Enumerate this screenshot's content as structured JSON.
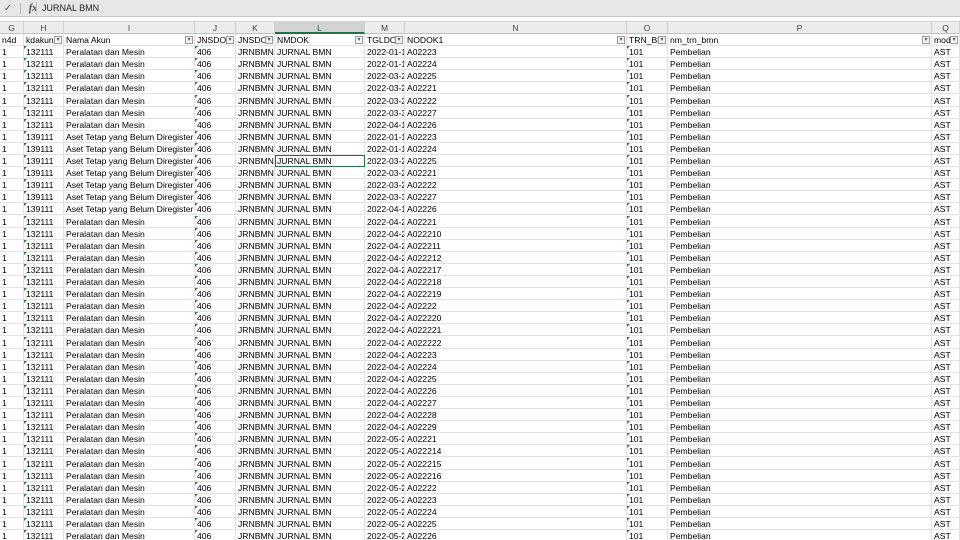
{
  "formula_bar": {
    "check_glyph": "✓",
    "fx_label": "fx",
    "value": "JURNAL BMN"
  },
  "columns": [
    {
      "letter": "G",
      "header": "n4d"
    },
    {
      "letter": "H",
      "header": "kdakun"
    },
    {
      "letter": "I",
      "header": "Nama Akun"
    },
    {
      "letter": "J",
      "header": "JNSDOK"
    },
    {
      "letter": "K",
      "header": "JNSDOK"
    },
    {
      "letter": "L",
      "header": "NMDOK"
    },
    {
      "letter": "M",
      "header": "TGLDOK"
    },
    {
      "letter": "N",
      "header": "NODOK1"
    },
    {
      "letter": "O",
      "header": "TRN_BM"
    },
    {
      "letter": "P",
      "header": "nm_trn_bmn"
    },
    {
      "letter": "Q",
      "header": "modul"
    }
  ],
  "active_column": "L",
  "selected_row": 9,
  "rows": [
    [
      "1",
      "132111",
      "Peralatan dan Mesin",
      "406",
      "JRNBMN",
      "JURNAL BMN",
      "2022-01-1",
      "A02223",
      "101",
      "Pembelian",
      "AST"
    ],
    [
      "1",
      "132111",
      "Peralatan dan Mesin",
      "406",
      "JRNBMN",
      "JURNAL BMN",
      "2022-01-1",
      "A02224",
      "101",
      "Pembelian",
      "AST"
    ],
    [
      "1",
      "132111",
      "Peralatan dan Mesin",
      "406",
      "JRNBMN",
      "JURNAL BMN",
      "2022-03-2",
      "A02225",
      "101",
      "Pembelian",
      "AST"
    ],
    [
      "1",
      "132111",
      "Peralatan dan Mesin",
      "406",
      "JRNBMN",
      "JURNAL BMN",
      "2022-03-2",
      "A02221",
      "101",
      "Pembelian",
      "AST"
    ],
    [
      "1",
      "132111",
      "Peralatan dan Mesin",
      "406",
      "JRNBMN",
      "JURNAL BMN",
      "2022-03-2",
      "A02222",
      "101",
      "Pembelian",
      "AST"
    ],
    [
      "1",
      "132111",
      "Peralatan dan Mesin",
      "406",
      "JRNBMN",
      "JURNAL BMN",
      "2022-03-3",
      "A02227",
      "101",
      "Pembelian",
      "AST"
    ],
    [
      "1",
      "132111",
      "Peralatan dan Mesin",
      "406",
      "JRNBMN",
      "JURNAL BMN",
      "2022-04-1",
      "A02226",
      "101",
      "Pembelian",
      "AST"
    ],
    [
      "1",
      "139111",
      "Aset Tetap yang Belum Diregister",
      "406",
      "JRNBMN",
      "JURNAL BMN",
      "2022-01-1",
      "A02223",
      "101",
      "Pembelian",
      "AST"
    ],
    [
      "1",
      "139111",
      "Aset Tetap yang Belum Diregister",
      "406",
      "JRNBMN",
      "JURNAL BMN",
      "2022-01-1",
      "A02224",
      "101",
      "Pembelian",
      "AST"
    ],
    [
      "1",
      "139111",
      "Aset Tetap yang Belum Diregister",
      "406",
      "JRNBMN",
      "JURNAL BMN",
      "2022-03-2",
      "A02225",
      "101",
      "Pembelian",
      "AST"
    ],
    [
      "1",
      "139111",
      "Aset Tetap yang Belum Diregister",
      "406",
      "JRNBMN",
      "JURNAL BMN",
      "2022-03-2",
      "A02221",
      "101",
      "Pembelian",
      "AST"
    ],
    [
      "1",
      "139111",
      "Aset Tetap yang Belum Diregister",
      "406",
      "JRNBMN",
      "JURNAL BMN",
      "2022-03-2",
      "A02222",
      "101",
      "Pembelian",
      "AST"
    ],
    [
      "1",
      "139111",
      "Aset Tetap yang Belum Diregister",
      "406",
      "JRNBMN",
      "JURNAL BMN",
      "2022-03-3",
      "A02227",
      "101",
      "Pembelian",
      "AST"
    ],
    [
      "1",
      "139111",
      "Aset Tetap yang Belum Diregister",
      "406",
      "JRNBMN",
      "JURNAL BMN",
      "2022-04-1",
      "A02226",
      "101",
      "Pembelian",
      "AST"
    ],
    [
      "1",
      "132111",
      "Peralatan dan Mesin",
      "406",
      "JRNBMN",
      "JURNAL BMN",
      "2022-04-2",
      "A02221",
      "101",
      "Pembelian",
      "AST"
    ],
    [
      "1",
      "132111",
      "Peralatan dan Mesin",
      "406",
      "JRNBMN",
      "JURNAL BMN",
      "2022-04-2",
      "A022210",
      "101",
      "Pembelian",
      "AST"
    ],
    [
      "1",
      "132111",
      "Peralatan dan Mesin",
      "406",
      "JRNBMN",
      "JURNAL BMN",
      "2022-04-2",
      "A022211",
      "101",
      "Pembelian",
      "AST"
    ],
    [
      "1",
      "132111",
      "Peralatan dan Mesin",
      "406",
      "JRNBMN",
      "JURNAL BMN",
      "2022-04-2",
      "A022212",
      "101",
      "Pembelian",
      "AST"
    ],
    [
      "1",
      "132111",
      "Peralatan dan Mesin",
      "406",
      "JRNBMN",
      "JURNAL BMN",
      "2022-04-2",
      "A022217",
      "101",
      "Pembelian",
      "AST"
    ],
    [
      "1",
      "132111",
      "Peralatan dan Mesin",
      "406",
      "JRNBMN",
      "JURNAL BMN",
      "2022-04-2",
      "A022218",
      "101",
      "Pembelian",
      "AST"
    ],
    [
      "1",
      "132111",
      "Peralatan dan Mesin",
      "406",
      "JRNBMN",
      "JURNAL BMN",
      "2022-04-2",
      "A022219",
      "101",
      "Pembelian",
      "AST"
    ],
    [
      "1",
      "132111",
      "Peralatan dan Mesin",
      "406",
      "JRNBMN",
      "JURNAL BMN",
      "2022-04-2",
      "A02222",
      "101",
      "Pembelian",
      "AST"
    ],
    [
      "1",
      "132111",
      "Peralatan dan Mesin",
      "406",
      "JRNBMN",
      "JURNAL BMN",
      "2022-04-2",
      "A022220",
      "101",
      "Pembelian",
      "AST"
    ],
    [
      "1",
      "132111",
      "Peralatan dan Mesin",
      "406",
      "JRNBMN",
      "JURNAL BMN",
      "2022-04-2",
      "A022221",
      "101",
      "Pembelian",
      "AST"
    ],
    [
      "1",
      "132111",
      "Peralatan dan Mesin",
      "406",
      "JRNBMN",
      "JURNAL BMN",
      "2022-04-2",
      "A022222",
      "101",
      "Pembelian",
      "AST"
    ],
    [
      "1",
      "132111",
      "Peralatan dan Mesin",
      "406",
      "JRNBMN",
      "JURNAL BMN",
      "2022-04-2",
      "A02223",
      "101",
      "Pembelian",
      "AST"
    ],
    [
      "1",
      "132111",
      "Peralatan dan Mesin",
      "406",
      "JRNBMN",
      "JURNAL BMN",
      "2022-04-2",
      "A02224",
      "101",
      "Pembelian",
      "AST"
    ],
    [
      "1",
      "132111",
      "Peralatan dan Mesin",
      "406",
      "JRNBMN",
      "JURNAL BMN",
      "2022-04-2",
      "A02225",
      "101",
      "Pembelian",
      "AST"
    ],
    [
      "1",
      "132111",
      "Peralatan dan Mesin",
      "406",
      "JRNBMN",
      "JURNAL BMN",
      "2022-04-2",
      "A02226",
      "101",
      "Pembelian",
      "AST"
    ],
    [
      "1",
      "132111",
      "Peralatan dan Mesin",
      "406",
      "JRNBMN",
      "JURNAL BMN",
      "2022-04-2",
      "A02227",
      "101",
      "Pembelian",
      "AST"
    ],
    [
      "1",
      "132111",
      "Peralatan dan Mesin",
      "406",
      "JRNBMN",
      "JURNAL BMN",
      "2022-04-2",
      "A02228",
      "101",
      "Pembelian",
      "AST"
    ],
    [
      "1",
      "132111",
      "Peralatan dan Mesin",
      "406",
      "JRNBMN",
      "JURNAL BMN",
      "2022-04-2",
      "A02229",
      "101",
      "Pembelian",
      "AST"
    ],
    [
      "1",
      "132111",
      "Peralatan dan Mesin",
      "406",
      "JRNBMN",
      "JURNAL BMN",
      "2022-05-2",
      "A02221",
      "101",
      "Pembelian",
      "AST"
    ],
    [
      "1",
      "132111",
      "Peralatan dan Mesin",
      "406",
      "JRNBMN",
      "JURNAL BMN",
      "2022-05-2",
      "A022214",
      "101",
      "Pembelian",
      "AST"
    ],
    [
      "1",
      "132111",
      "Peralatan dan Mesin",
      "406",
      "JRNBMN",
      "JURNAL BMN",
      "2022-05-2",
      "A022215",
      "101",
      "Pembelian",
      "AST"
    ],
    [
      "1",
      "132111",
      "Peralatan dan Mesin",
      "406",
      "JRNBMN",
      "JURNAL BMN",
      "2022-05-2",
      "A022216",
      "101",
      "Pembelian",
      "AST"
    ],
    [
      "1",
      "132111",
      "Peralatan dan Mesin",
      "406",
      "JRNBMN",
      "JURNAL BMN",
      "2022-05-2",
      "A02222",
      "101",
      "Pembelian",
      "AST"
    ],
    [
      "1",
      "132111",
      "Peralatan dan Mesin",
      "406",
      "JRNBMN",
      "JURNAL BMN",
      "2022-05-2",
      "A02223",
      "101",
      "Pembelian",
      "AST"
    ],
    [
      "1",
      "132111",
      "Peralatan dan Mesin",
      "406",
      "JRNBMN",
      "JURNAL BMN",
      "2022-05-2",
      "A02224",
      "101",
      "Pembelian",
      "AST"
    ],
    [
      "1",
      "132111",
      "Peralatan dan Mesin",
      "406",
      "JRNBMN",
      "JURNAL BMN",
      "2022-05-2",
      "A02225",
      "101",
      "Pembelian",
      "AST"
    ],
    [
      "1",
      "132111",
      "Peralatan dan Mesin",
      "406",
      "JRNBMN",
      "JURNAL BMN",
      "2022-05-2",
      "A02226",
      "101",
      "Pembelian",
      "AST"
    ]
  ],
  "colors": {
    "accent": "#217346",
    "error_triangle": "#2f7d3a"
  }
}
